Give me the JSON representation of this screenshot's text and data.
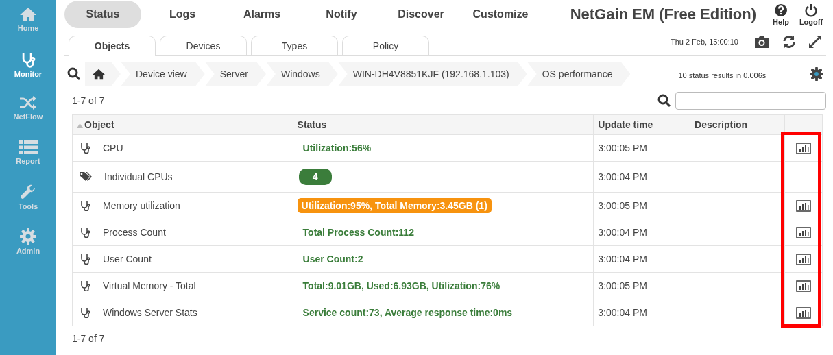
{
  "sidebar": {
    "items": [
      {
        "label": "Home",
        "selected": false
      },
      {
        "label": "Monitor",
        "selected": true
      },
      {
        "label": "NetFlow",
        "selected": false
      },
      {
        "label": "Report",
        "selected": false
      },
      {
        "label": "Tools",
        "selected": false
      },
      {
        "label": "Admin",
        "selected": false
      }
    ]
  },
  "main_tabs": [
    {
      "label": "Status",
      "selected": true
    },
    {
      "label": "Logs",
      "selected": false
    },
    {
      "label": "Alarms",
      "selected": false
    },
    {
      "label": "Notify",
      "selected": false
    },
    {
      "label": "Discover",
      "selected": false
    },
    {
      "label": "Customize",
      "selected": false
    }
  ],
  "app_title": "NetGain EM (Free Edition)",
  "header_buttons": [
    "Help",
    "Logoff"
  ],
  "sub_tabs": [
    {
      "label": "Objects",
      "selected": true
    },
    {
      "label": "Devices",
      "selected": false
    },
    {
      "label": "Types",
      "selected": false
    },
    {
      "label": "Policy",
      "selected": false
    }
  ],
  "datetime": "Thu 2 Feb, 15:00:10",
  "breadcrumb": [
    "Device view",
    "Server",
    "Windows",
    "WIN-DH4V8851KJF (192.168.1.103)",
    "OS performance"
  ],
  "results_info": "10 status results in 0.006s",
  "pager_top": "1-7 of 7",
  "table": {
    "columns": [
      "Object",
      "Status",
      "Update time",
      "Description"
    ],
    "rows": [
      {
        "kind": "monitor",
        "object": "CPU",
        "status": {
          "kind": "text",
          "text": "Utilization:56%"
        },
        "update_time": "3:00:05 PM",
        "chart": true
      },
      {
        "kind": "tag",
        "object": "Individual CPUs",
        "status": {
          "kind": "count",
          "text": "4"
        },
        "update_time": "3:00:04 PM",
        "chart": false
      },
      {
        "kind": "monitor",
        "object": "Memory utilization",
        "status": {
          "kind": "warning",
          "text": "Utilization:95%, Total Memory:3.45GB (1)"
        },
        "update_time": "3:00:05 PM",
        "chart": true
      },
      {
        "kind": "monitor",
        "object": "Process Count",
        "status": {
          "kind": "text",
          "text": "Total Process Count:112"
        },
        "update_time": "3:00:04 PM",
        "chart": true
      },
      {
        "kind": "monitor",
        "object": "User Count",
        "status": {
          "kind": "text",
          "text": "User Count:2"
        },
        "update_time": "3:00:04 PM",
        "chart": true
      },
      {
        "kind": "monitor",
        "object": "Virtual Memory - Total",
        "status": {
          "kind": "text",
          "text": "Total:9.01GB, Used:6.93GB, Utilization:76%"
        },
        "update_time": "3:00:05 PM",
        "chart": true
      },
      {
        "kind": "monitor",
        "object": "Windows Server Stats",
        "status": {
          "kind": "text",
          "text": "Service count:73, Average response time:0ms"
        },
        "update_time": "3:00:04 PM",
        "chart": true
      }
    ]
  },
  "pager_bottom": "1-7 of 7"
}
